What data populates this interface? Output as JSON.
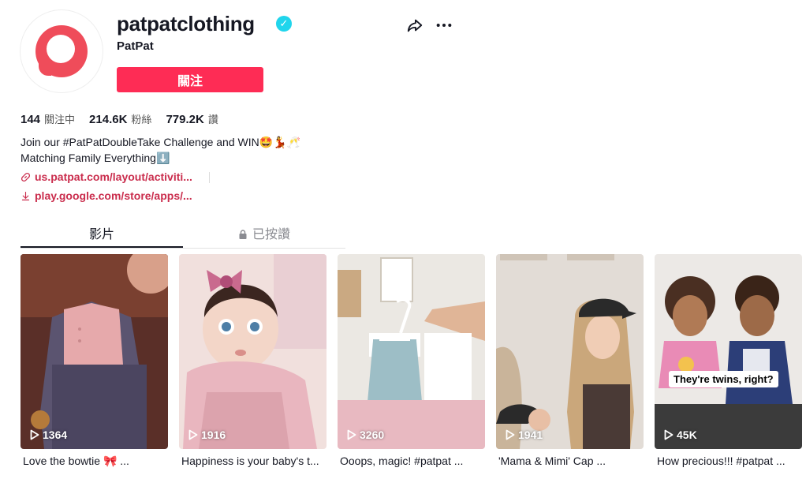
{
  "profile": {
    "username": "patpatclothing",
    "nickname": "PatPat",
    "verified_mark": "✓",
    "follow_label": "關注"
  },
  "stats": {
    "following_value": "144",
    "following_label": "關注中",
    "followers_value": "214.6K",
    "followers_label": "粉絲",
    "likes_value": "779.2K",
    "likes_label": "讚"
  },
  "bio": {
    "line1": "Join our #PatPatDoubleTake Challenge and WIN🤩💃🥂",
    "line2": "Matching Family Everything⬇️",
    "link1": "us.patpat.com/layout/activiti...",
    "link2": "play.google.com/store/apps/..."
  },
  "tabs": {
    "videos": "影片",
    "liked": "已按讚"
  },
  "videos": [
    {
      "plays": "1364",
      "caption": "Love the bowtie 🎀 ..."
    },
    {
      "plays": "1916",
      "caption": "Happiness is your baby's t..."
    },
    {
      "plays": "3260",
      "caption": "Ooops, magic! #patpat ..."
    },
    {
      "plays": "1941",
      "caption": "'Mama & Mimi' Cap ..."
    },
    {
      "plays": "45K",
      "caption": "How precious!!! #patpat ...",
      "overlay": "They're twins, right?"
    }
  ],
  "icons": {
    "share": "share-icon",
    "more": "more-icon",
    "link": "link-icon",
    "download": "download-icon",
    "lock": "lock-icon",
    "play": "play-icon"
  },
  "colors": {
    "accent": "#fe2c55",
    "verified": "#20d5ec",
    "link": "#ca2d4d"
  }
}
